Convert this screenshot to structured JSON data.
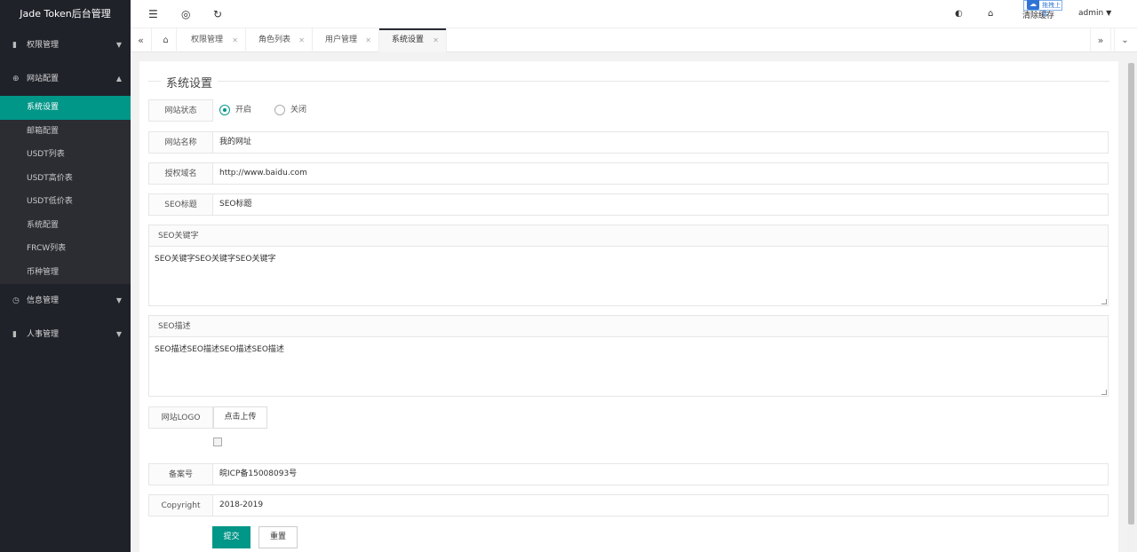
{
  "sidebar": {
    "logo": "Jade Token后台管理",
    "groups": [
      {
        "label": "权限管理",
        "icon": "▮"
      },
      {
        "label": "网站配置",
        "icon": "⊕",
        "items": [
          "系统设置",
          "邮箱配置",
          "USDT列表",
          "USDT高价表",
          "USDT低价表",
          "系统配置",
          "FRCW列表",
          "币种管理"
        ]
      },
      {
        "label": "信息管理",
        "icon": "◷"
      },
      {
        "label": "人事管理",
        "icon": "▮"
      }
    ]
  },
  "header": {
    "drag_upload": "拖拽上传",
    "clear_cache": "清除缓存",
    "user": "admin"
  },
  "tabs": [
    "权限管理",
    "角色列表",
    "用户管理",
    "系统设置"
  ],
  "form": {
    "section_title": "系统设置",
    "site_status_label": "网站状态",
    "radio_on": "开启",
    "radio_off": "关闭",
    "site_name_label": "网站名称",
    "site_name_value": "我的网址",
    "domain_label": "授权域名",
    "domain_value": "http://www.baidu.com",
    "seo_title_label": "SEO标题",
    "seo_title_value": "SEO标题",
    "seo_keywords_label": "SEO关键字",
    "seo_keywords_value": "SEO关键字SEO关键字SEO关键字",
    "seo_desc_label": "SEO描述",
    "seo_desc_value": "SEO描述SEO描述SEO描述SEO描述",
    "logo_label": "网站LOGO",
    "upload_button": "点击上传",
    "icp_label": "备案号",
    "icp_value": "皖ICP备15008093号",
    "copyright_label": "Copyright",
    "copyright_value": "2018-2019",
    "submit_button": "提交",
    "reset_button": "重置"
  }
}
